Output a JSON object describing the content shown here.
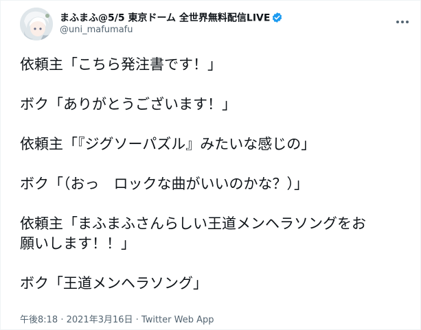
{
  "colors": {
    "text": "#0f1419",
    "secondary": "#536471",
    "verified": "#1d9bf0",
    "border": "#eff3f4"
  },
  "user": {
    "display_name": "まふまふ@5/5 東京ドーム 全世界無料配信LIVE",
    "handle": "@uni_mafumafu",
    "verified_icon": "verified-badge-icon",
    "avatar": "avatar"
  },
  "more_icon": "more-options-icon",
  "tweet": {
    "lines": [
      "依頼主「こちら発注書です！」",
      "ボク「ありがとうございます！」",
      "依頼主「『ジグソーパズル』みたいな感じの」",
      "ボク「（おっ　ロックな曲がいいのかな？）」",
      "依頼主「まふまふさんらしい王道メンヘラソングをお",
      "願いします！！」",
      "ボク「王道メンヘラソング」"
    ]
  },
  "meta": {
    "time": "午後8:18",
    "separator1": " · ",
    "date": "2021年3月16日",
    "separator2": " · ",
    "source": "Twitter Web App"
  }
}
